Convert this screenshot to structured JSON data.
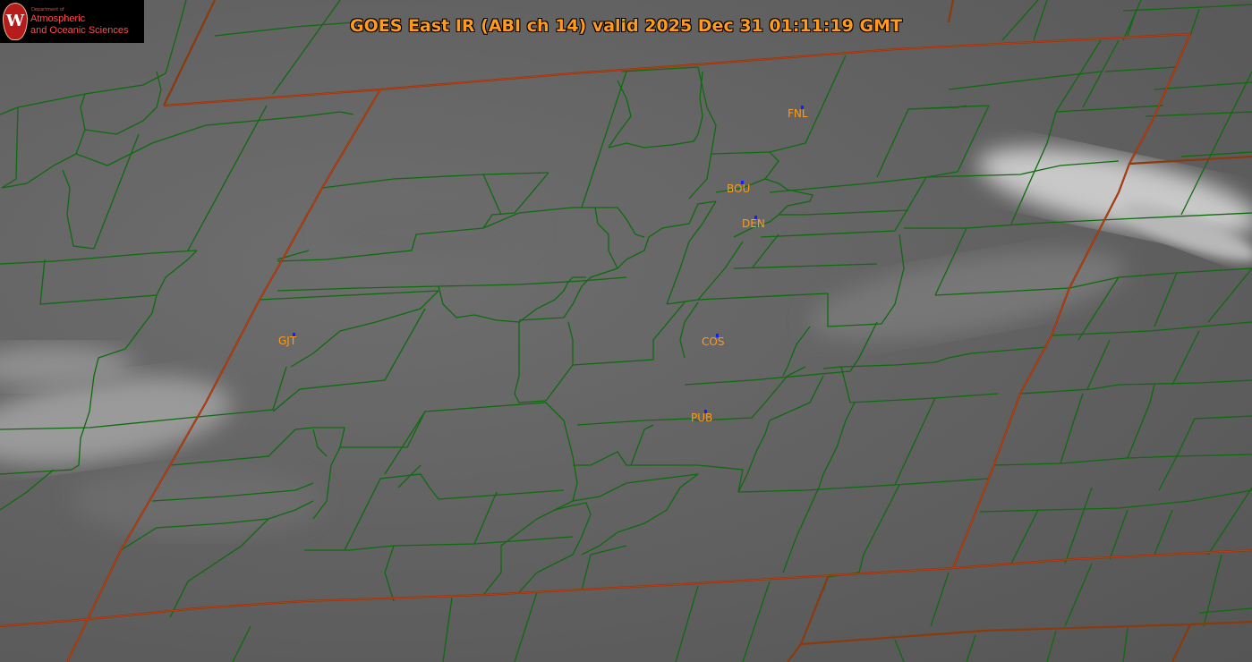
{
  "title": "GOES East IR (ABI ch 14) valid 2025 Dec 31 01:11:19 GMT",
  "logo": {
    "dept_text": "Department of",
    "line1": "Atmospheric",
    "line2": "and Oceanic Sciences",
    "seal_letter": "W"
  },
  "stations": [
    {
      "id": "FNL"
    },
    {
      "id": "BOU"
    },
    {
      "id": "DEN"
    },
    {
      "id": "GJT"
    },
    {
      "id": "COS"
    },
    {
      "id": "PUB"
    }
  ],
  "colors": {
    "county_lines": "#0e6b0e",
    "state_lines": "#8a3a0c",
    "station_labels": "#ff9a1a",
    "station_markers": "#1020ff",
    "title_text": "#ff9a1a"
  }
}
